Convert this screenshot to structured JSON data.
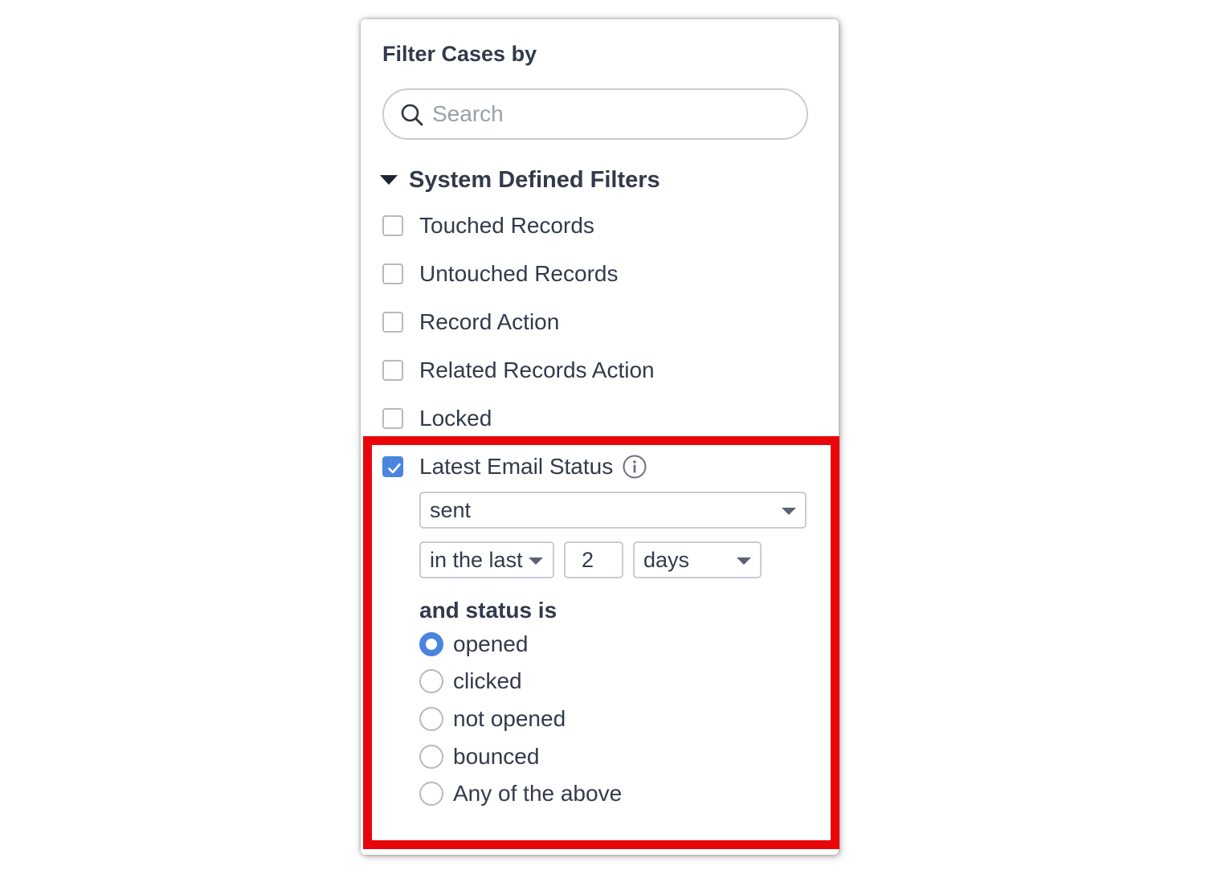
{
  "panel": {
    "title": "Filter Cases by",
    "search": {
      "placeholder": "Search",
      "value": ""
    }
  },
  "section": {
    "label": "System Defined Filters",
    "expanded": true
  },
  "filters": [
    {
      "label": "Touched Records",
      "checked": false
    },
    {
      "label": "Untouched Records",
      "checked": false
    },
    {
      "label": "Record Action",
      "checked": false
    },
    {
      "label": "Related Records Action",
      "checked": false
    },
    {
      "label": "Locked",
      "checked": false
    },
    {
      "label": "Latest Email Status",
      "checked": true
    }
  ],
  "email_status": {
    "event_select": "sent",
    "period_select": "in the last",
    "period_count": "2",
    "unit_select": "days",
    "status_heading": "and status is",
    "options": [
      {
        "label": "opened",
        "selected": true
      },
      {
        "label": "clicked",
        "selected": false
      },
      {
        "label": "not opened",
        "selected": false
      },
      {
        "label": "bounced",
        "selected": false
      },
      {
        "label": "Any of the above",
        "selected": false
      }
    ]
  },
  "colors": {
    "accent": "#4a84e0",
    "highlight": "#e8060b",
    "text": "#323a4b"
  }
}
